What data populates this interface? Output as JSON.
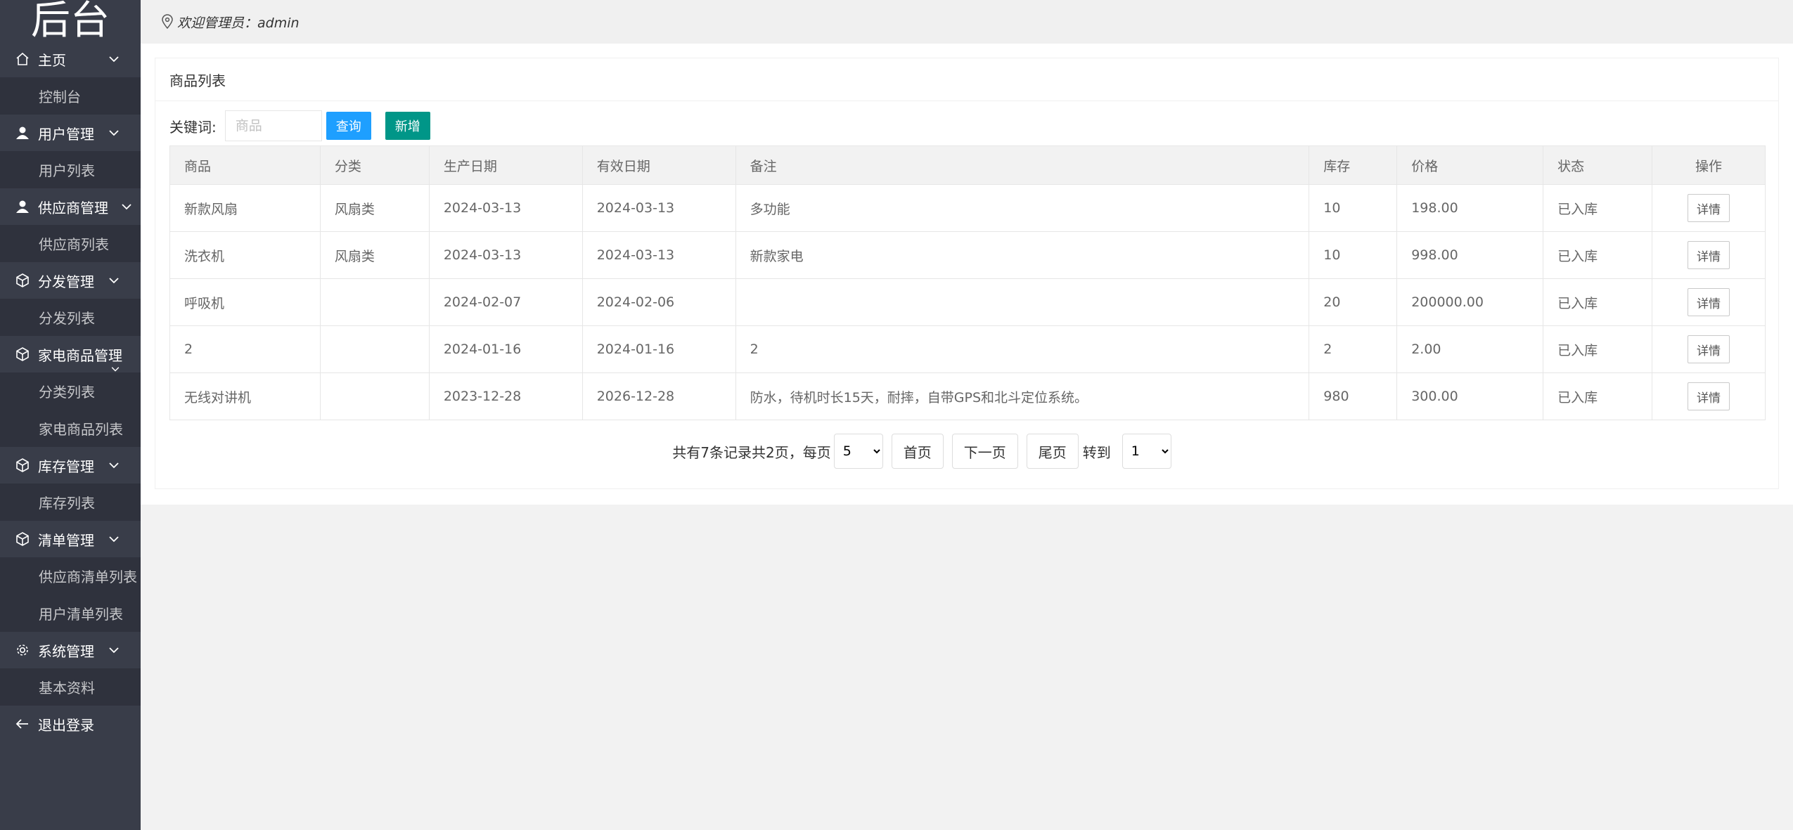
{
  "sidebar": {
    "logo": "后台",
    "groups": [
      {
        "label": "主页",
        "items": [
          "控制台"
        ]
      },
      {
        "label": "用户管理",
        "items": [
          "用户列表"
        ]
      },
      {
        "label": "供应商管理",
        "items": [
          "供应商列表"
        ]
      },
      {
        "label": "分发管理",
        "items": [
          "分发列表"
        ]
      },
      {
        "label": "家电商品管理",
        "items": [
          "分类列表",
          "家电商品列表"
        ]
      },
      {
        "label": "库存管理",
        "items": [
          "库存列表"
        ]
      },
      {
        "label": "清单管理",
        "items": [
          "供应商清单列表",
          "用户清单列表"
        ]
      },
      {
        "label": "系统管理",
        "items": [
          "基本资料"
        ]
      }
    ],
    "logout": "退出登录"
  },
  "topbar": {
    "welcome": "欢迎管理员：admin"
  },
  "panel": {
    "title": "商品列表"
  },
  "toolbar": {
    "keyword_label": "关键词:",
    "search_placeholder": "商品",
    "search_value": "",
    "query_button": "查询",
    "add_button": "新增"
  },
  "table": {
    "headers": [
      "商品",
      "分类",
      "生产日期",
      "有效日期",
      "备注",
      "库存",
      "价格",
      "状态",
      "操作"
    ],
    "rows": [
      {
        "name": "新款风扇",
        "category": "风扇类",
        "produced": "2024-03-13",
        "expires": "2024-03-13",
        "note": "多功能",
        "stock": "10",
        "price": "198.00",
        "status": "已入库",
        "action": "详情"
      },
      {
        "name": "洗衣机",
        "category": "风扇类",
        "produced": "2024-03-13",
        "expires": "2024-03-13",
        "note": "新款家电",
        "stock": "10",
        "price": "998.00",
        "status": "已入库",
        "action": "详情"
      },
      {
        "name": "呼吸机",
        "category": "",
        "produced": "2024-02-07",
        "expires": "2024-02-06",
        "note": "",
        "stock": "20",
        "price": "200000.00",
        "status": "已入库",
        "action": "详情"
      },
      {
        "name": "2",
        "category": "",
        "produced": "2024-01-16",
        "expires": "2024-01-16",
        "note": "2",
        "stock": "2",
        "price": "2.00",
        "status": "已入库",
        "action": "详情"
      },
      {
        "name": "无线对讲机",
        "category": "",
        "produced": "2023-12-28",
        "expires": "2026-12-28",
        "note": "防水，待机时长15天，耐摔，自带GPS和北斗定位系统。",
        "stock": "980",
        "price": "300.00",
        "status": "已入库",
        "action": "详情"
      }
    ]
  },
  "pager": {
    "summary": "共有7条记录共2页，每页",
    "page_size": "5",
    "first": "首页",
    "next": "下一页",
    "last": "尾页",
    "goto_label": "转到",
    "goto_page": "1"
  },
  "colors": {
    "sidebar_bg": "#393d49",
    "submenu_bg": "#2f323d",
    "query_button": "#1e9fff",
    "add_button": "#009688",
    "status_green": "#2b9c2b"
  }
}
